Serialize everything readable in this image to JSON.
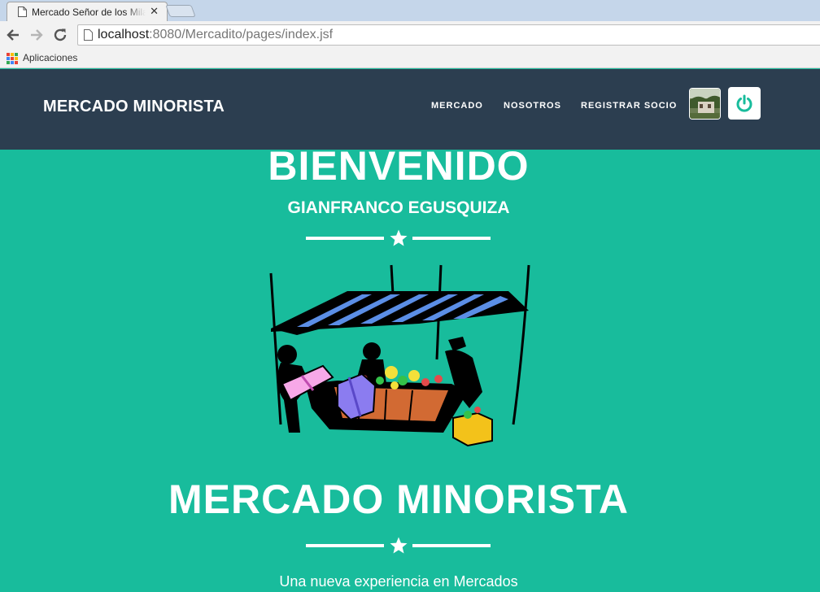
{
  "browser": {
    "tab_title": "Mercado Señor de los Milagros",
    "close_glyph": "✕",
    "url_host": "localhost",
    "url_path": ":8080/Mercadito/pages/index.jsf",
    "bookmark_label": "Aplicaciones"
  },
  "navbar": {
    "brand": "MERCADO MINORISTA",
    "items": [
      {
        "label": "MERCADO"
      },
      {
        "label": "NOSOTROS"
      },
      {
        "label": "REGISTRAR SOCIO"
      }
    ],
    "avatar_icon": "profile-photo",
    "logout_icon": "power-icon"
  },
  "hero": {
    "welcome": "BIENVENIDO",
    "user_name": "GIANFRANCO EGUSQUIZA",
    "illustration": "market-stall-illustration",
    "title": "MERCADO MINORISTA",
    "tagline": "Una nueva experiencia en Mercados"
  },
  "colors": {
    "primary": "#2c3e50",
    "accent": "#18bc9c",
    "text": "#ffffff"
  }
}
